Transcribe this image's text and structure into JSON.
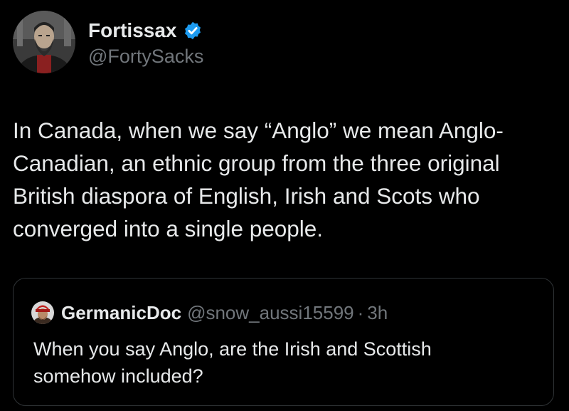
{
  "tweet": {
    "author": {
      "display_name": "Fortissax",
      "handle": "@FortySacks",
      "verified": true,
      "verified_color": "#1d9bf0",
      "avatar_icon": "bearded-man-avatar"
    },
    "text_lines": [
      "In Canada, when we say “Anglo” we mean Anglo-",
      "Canadian, an ethnic group from the three original",
      "British diaspora of English, Irish and Scots who",
      "converged into a single people."
    ],
    "quote": {
      "display_name": "GermanicDoc",
      "handle": "@snow_aussi15599",
      "separator": "·",
      "time": "3h",
      "avatar_icon": "red-helmet-avatar",
      "text_lines": [
        "When you say Anglo, are the Irish and Scottish",
        "somehow included?"
      ]
    }
  },
  "colors": {
    "background": "#000000",
    "primary_text": "#e7e9ea",
    "secondary_text": "#71767b",
    "border": "#2f3336"
  }
}
